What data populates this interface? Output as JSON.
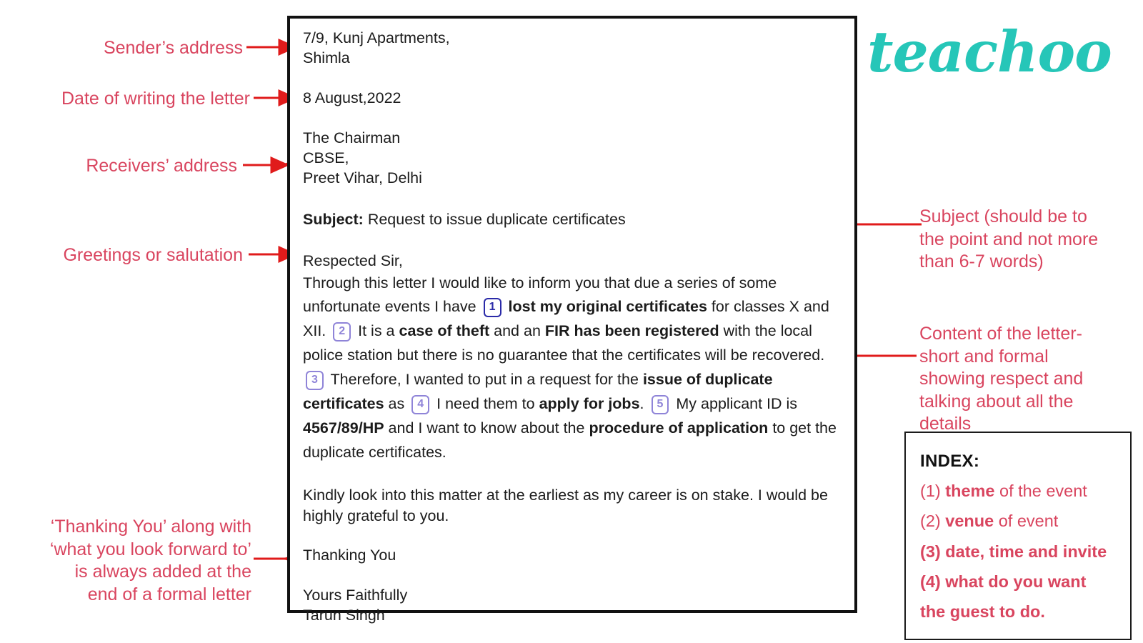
{
  "brand": {
    "logo_text": "teachoo",
    "logo_color": "#26c6b8"
  },
  "colors": {
    "annotation_red": "#d9455f",
    "arrow_red": "#e01b1b",
    "marker_first": "#2a2aa8",
    "marker_rest": "#8f84d8",
    "letter_border": "#111111"
  },
  "letter": {
    "sender_address": {
      "line1": "7/9, Kunj Apartments,",
      "line2": "Shimla"
    },
    "date": "8 August,2022",
    "receiver_address": {
      "line1": "The Chairman",
      "line2": "CBSE,",
      "line3": "Preet Vihar, Delhi"
    },
    "subject_label": "Subject:",
    "subject_text": "Request to issue duplicate certificates",
    "salutation": "Respected Sir,",
    "body": {
      "seg1": "Through this letter I would like to inform you that due a series of some unfortunate events I have",
      "marker1": "1",
      "bold1": "lost my original certificates",
      "seg2": "for classes X and XII.",
      "marker2": "2",
      "seg3": "It is a",
      "bold2": "case of theft",
      "seg4": "and an",
      "bold3": "FIR has been registered",
      "seg5": "with the local police station but there is no guarantee that the certificates will be recovered.",
      "marker3": "3",
      "seg6": "Therefore, I wanted to put in a request for the",
      "bold4": "issue of duplicate certificates",
      "seg7": "as",
      "marker4": "4",
      "seg8": "I need them to",
      "bold5": "apply for jobs",
      "seg9": ".",
      "marker5": "5",
      "seg10": "My applicant ID is",
      "bold6": "4567/89/HP",
      "seg11": "and I want to know about the",
      "bold7": "procedure of application",
      "seg12": "to get the duplicate certificates."
    },
    "closing_request": "Kindly look into this matter at the earliest as my career is on stake. I would be highly grateful to you.",
    "thanking": "Thanking You",
    "sign_off": "Yours Faithfully",
    "sender_name": "Tarun Singh"
  },
  "annotations": {
    "sender": "Sender’s address",
    "date": "Date of writing the letter",
    "receiver": "Receivers’ address",
    "salutation": "Greetings or salutation",
    "thanking": "‘Thanking You’ along with\n‘what you look forward to’\nis always added at the\nend of a formal letter",
    "subject": "Subject (should be to\nthe point and not more\nthan 6-7 words)",
    "content": "Content of the letter-\nshort and formal\nshowing respect and\ntalking about all the\ndetails"
  },
  "index": {
    "title": "INDEX:",
    "items": [
      {
        "num": "(1)",
        "bold": "theme",
        "rest": "of the event"
      },
      {
        "num": "(2)",
        "bold": "venue",
        "rest": "of event"
      },
      {
        "num": "(3)",
        "bold": "date, time and invite",
        "rest": ""
      },
      {
        "num": "(4)",
        "bold": "what do you want",
        "rest": ""
      },
      {
        "num": "",
        "bold": "the guest to do.",
        "rest": ""
      }
    ]
  }
}
